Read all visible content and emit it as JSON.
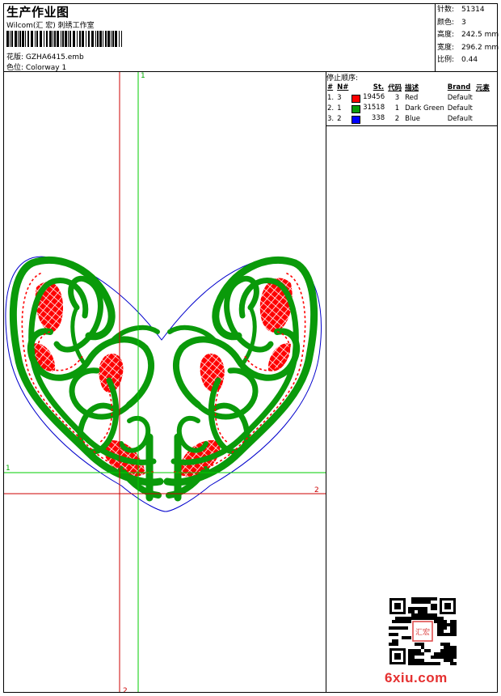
{
  "header": {
    "title": "生产作业图",
    "company": "Wilcom(汇 宏) 刺绣工作室",
    "design_label": "花版:",
    "design_value": "GZHA6415.emb",
    "colorway_label": "色位:",
    "colorway_value": "Colorway 1"
  },
  "stats": [
    {
      "label": "针数:",
      "value": "51314"
    },
    {
      "label": "颜色:",
      "value": "3"
    },
    {
      "label": "高度:",
      "value": "242.5 mm"
    },
    {
      "label": "宽度:",
      "value": "296.2 mm"
    },
    {
      "label": "比例:",
      "value": "0.44"
    }
  ],
  "stop_sequence": {
    "title": "停止顺序:",
    "columns": [
      "#",
      "N#",
      "St.",
      "代码",
      "描述",
      "Brand",
      "元素"
    ],
    "rows": [
      {
        "index": "1.",
        "n": "3",
        "color": "#ff0000",
        "stitches": "19456",
        "code": "3",
        "desc": "Red",
        "brand": "Default"
      },
      {
        "index": "2.",
        "n": "1",
        "color": "#0a9a0a",
        "stitches": "31518",
        "code": "1",
        "desc": "Dark Green",
        "brand": "Default"
      },
      {
        "index": "3.",
        "n": "2",
        "color": "#0000ff",
        "stitches": "338",
        "code": "2",
        "desc": "Blue",
        "brand": "Default"
      }
    ]
  },
  "guides": {
    "green_v_label": "1",
    "green_h_label": "1",
    "red_h_label": "2",
    "red_v_label": "2"
  },
  "watermark": {
    "text": "6xiu.com",
    "seal_text": "汇宏"
  },
  "colors": {
    "red": "#ff0000",
    "green": "#0a9a0a",
    "blue": "#0000cc",
    "guide_green": "#00cc00",
    "guide_red": "#cc0000",
    "brand": "#e53030"
  }
}
